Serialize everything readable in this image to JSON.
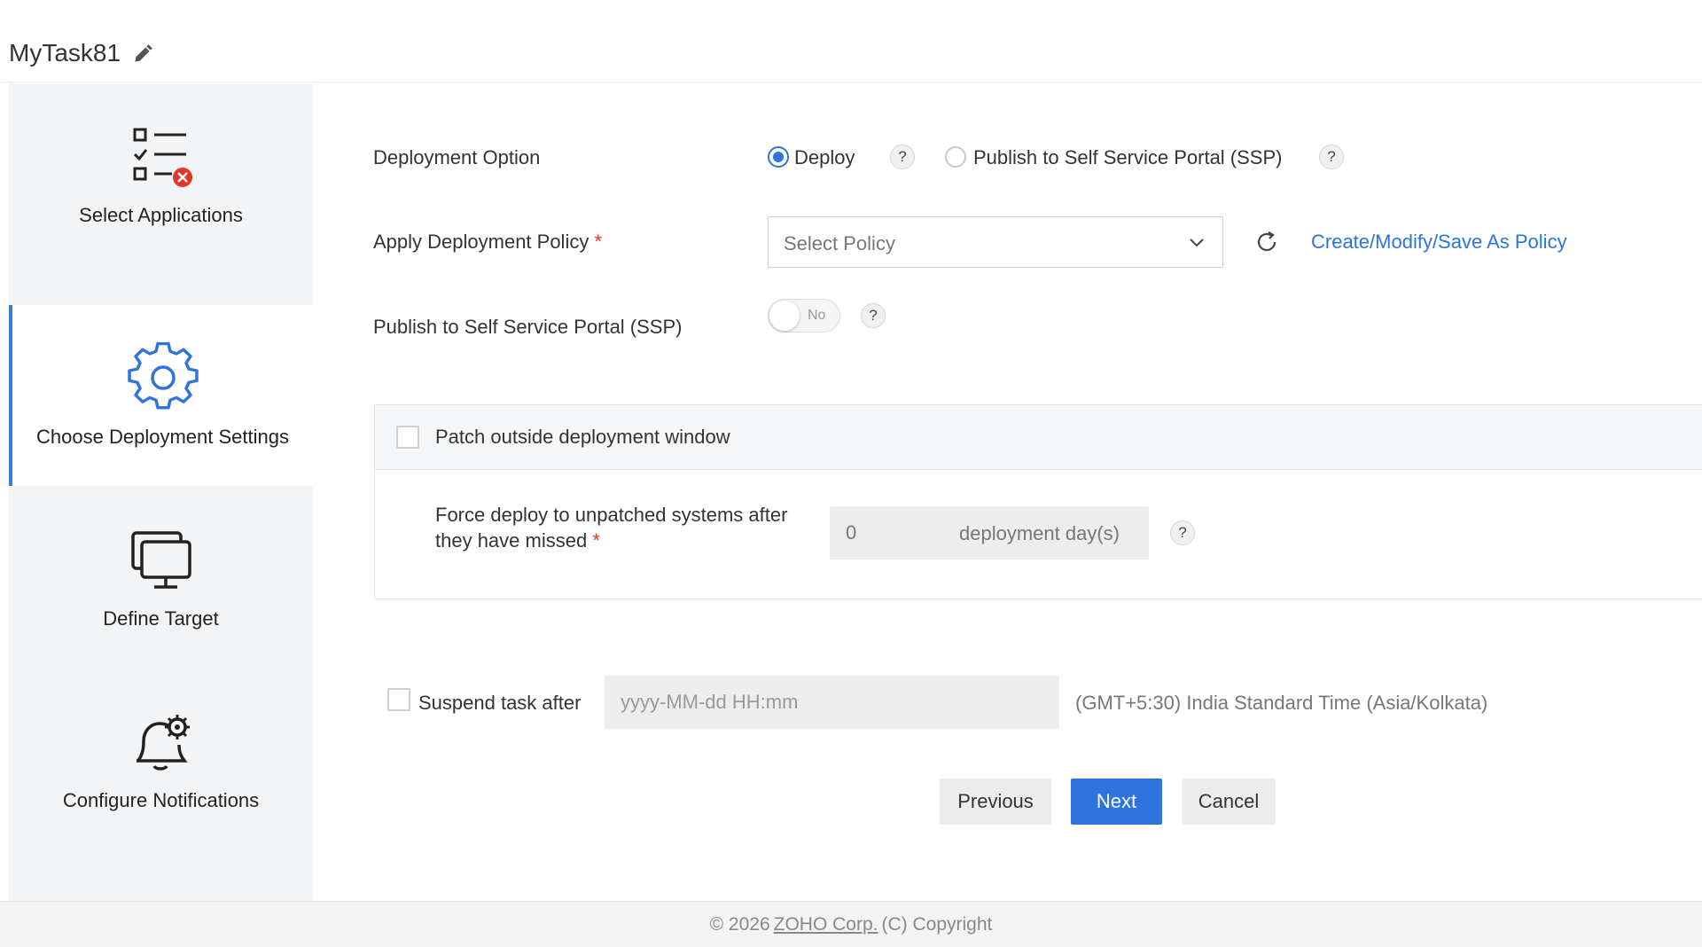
{
  "task": {
    "title": "MyTask81",
    "edit_icon": "pencil-icon"
  },
  "sidebar": {
    "items": [
      {
        "label": "Select Applications",
        "icon": "checklist-error-icon",
        "active": false
      },
      {
        "label": "Choose Deployment Settings",
        "icon": "gear-icon",
        "active": true
      },
      {
        "label": "Define Target",
        "icon": "monitor-icon",
        "active": false
      },
      {
        "label": "Configure Notifications",
        "icon": "bell-gear-icon",
        "active": false
      }
    ]
  },
  "form": {
    "deployment_option": {
      "label": "Deployment Option",
      "options": [
        {
          "label": "Deploy",
          "selected": true
        },
        {
          "label": "Publish to Self Service Portal (SSP)",
          "selected": false
        }
      ]
    },
    "policy": {
      "label": "Apply Deployment Policy",
      "required_mark": "*",
      "placeholder": "Select Policy",
      "link": "Create/Modify/Save As Policy"
    },
    "publish_ssp": {
      "label": "Publish to Self Service Portal (SSP)",
      "toggle_text": "No",
      "enabled": false
    },
    "patch_window": {
      "label": "Patch outside deployment window",
      "checked": false,
      "force_deploy_label_line1": "Force deploy to unpatched systems after",
      "force_deploy_label_line2": "they have missed",
      "required_mark": "*",
      "days_value": "0",
      "days_unit": "deployment day(s)"
    },
    "suspend": {
      "label": "Suspend task after",
      "checked": false,
      "placeholder": "yyyy-MM-dd HH:mm",
      "timezone": "(GMT+5:30) India Standard Time (Asia/Kolkata)"
    },
    "help_glyph": "?"
  },
  "buttons": {
    "previous": "Previous",
    "next": "Next",
    "cancel": "Cancel"
  },
  "footer": {
    "prefix": "© 2026",
    "company": "ZOHO Corp.",
    "suffix": "(C) Copyright"
  },
  "colors": {
    "accent": "#2f73e0",
    "link": "#2b74e0",
    "error": "#e0352b",
    "sidebar_bg": "#f3f4f6"
  }
}
